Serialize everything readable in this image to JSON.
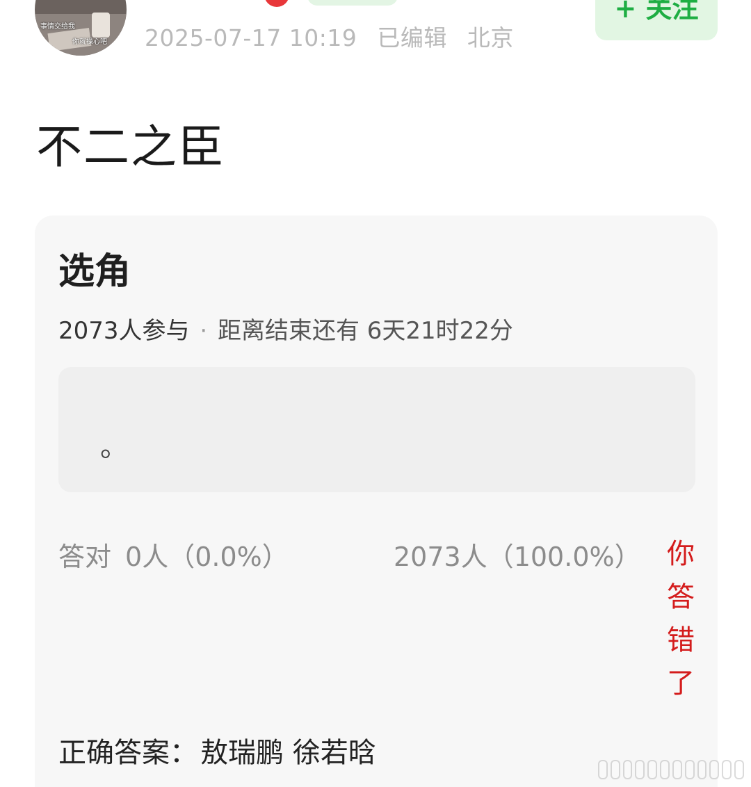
{
  "post": {
    "timestamp": "2025-07-17 10:19",
    "edited": "已编辑",
    "location": "北京",
    "follow_label": "+ 关注",
    "text": "不二之臣"
  },
  "avatar": {
    "caption_line1": "事情交给我",
    "caption_line2": "你就操心吧"
  },
  "quiz": {
    "title": "选角",
    "participants": "2073人参与",
    "separator": "·",
    "countdown": "距离结束还有 6天21时22分",
    "option_text": "。",
    "correct_label": "答对",
    "correct_count": "0人（0.0%）",
    "wrong_count": "2073人（100.0%）",
    "result": "你答错了",
    "answer_label": "正确答案：",
    "answer_names": "敖瑞鹏 徐若晗"
  },
  "colors": {
    "accent_green": "#1eae43",
    "follow_bg": "#e2f6e3",
    "error_red": "#d41c1c",
    "card_bg": "#f7f7f7"
  }
}
